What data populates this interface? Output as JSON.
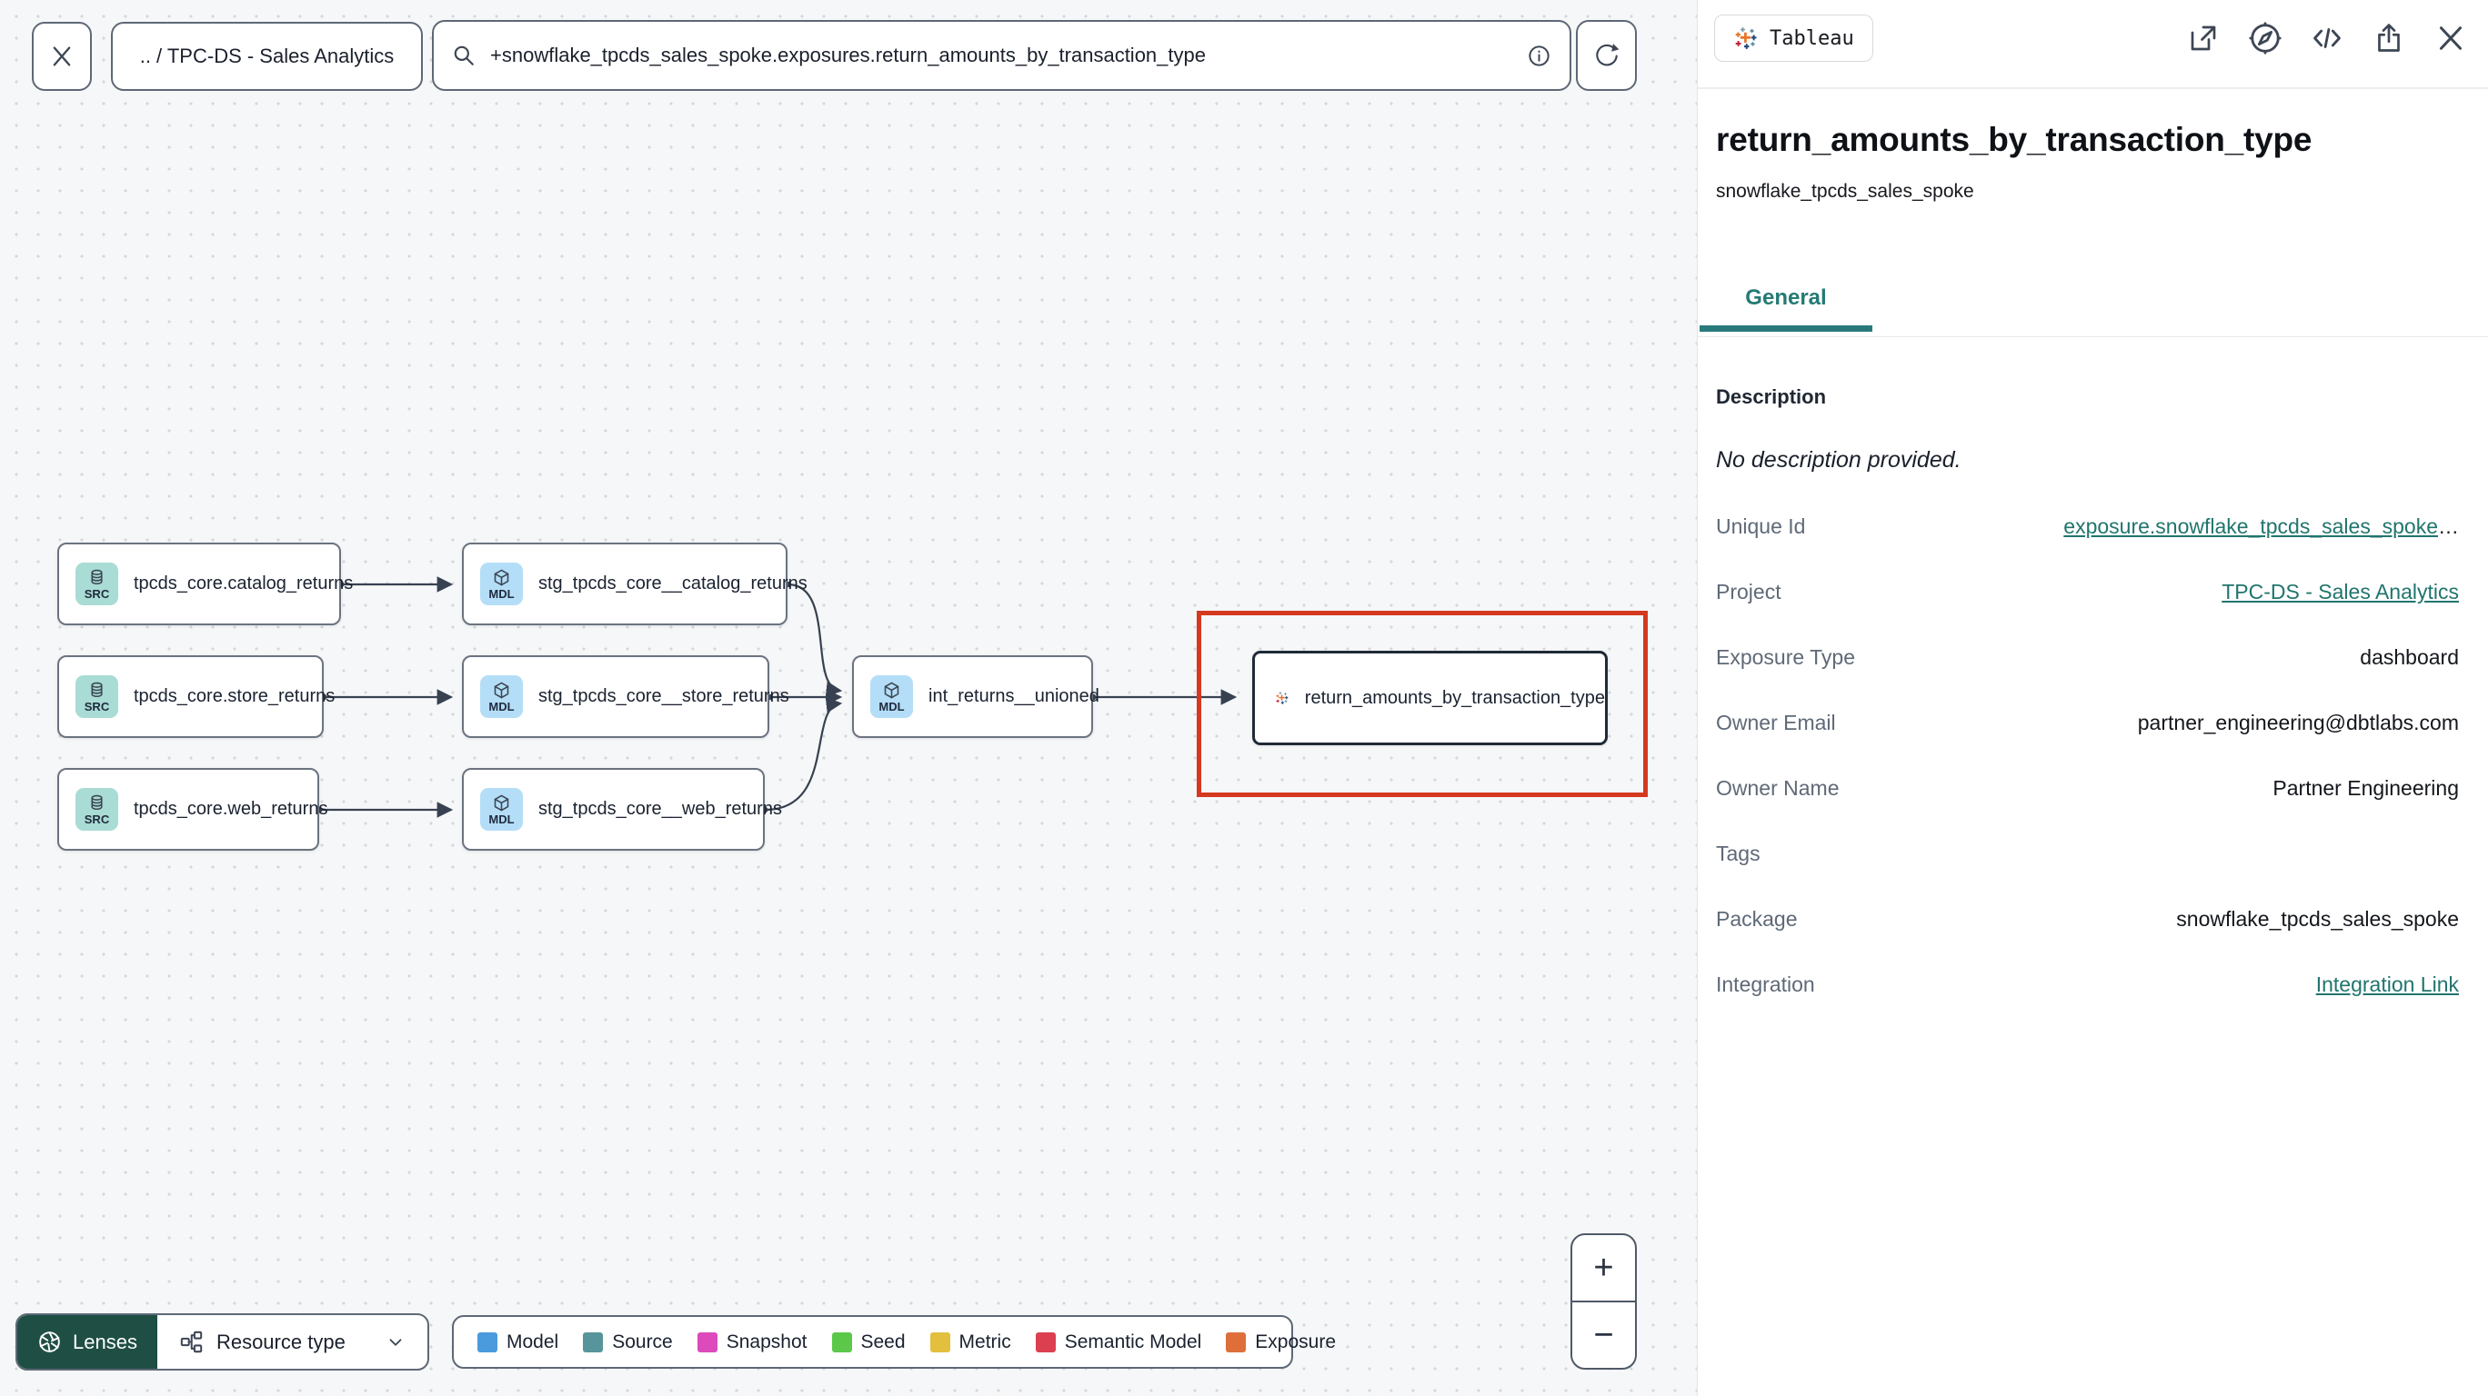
{
  "topbar": {
    "breadcrumb": ".. / TPC-DS - Sales Analytics",
    "search_value": "+snowflake_tpcds_sales_spoke.exposures.return_amounts_by_transaction_type"
  },
  "graph": {
    "nodes": [
      {
        "type": "source",
        "badge": "SRC",
        "label": "tpcds_core.catalog_returns"
      },
      {
        "type": "source",
        "badge": "SRC",
        "label": "tpcds_core.store_returns"
      },
      {
        "type": "source",
        "badge": "SRC",
        "label": "tpcds_core.web_returns"
      },
      {
        "type": "model",
        "badge": "MDL",
        "label": "stg_tpcds_core__catalog_returns"
      },
      {
        "type": "model",
        "badge": "MDL",
        "label": "stg_tpcds_core__store_returns"
      },
      {
        "type": "model",
        "badge": "MDL",
        "label": "stg_tpcds_core__web_returns"
      },
      {
        "type": "model",
        "badge": "MDL",
        "label": "int_returns__unioned"
      },
      {
        "type": "exposure",
        "badge": "",
        "label": "return_amounts_by_transaction_type"
      }
    ]
  },
  "panel": {
    "badge_label": "Tableau",
    "title": "return_amounts_by_transaction_type",
    "subtitle": "snowflake_tpcds_sales_spoke",
    "tab_label": "General",
    "description_label": "Description",
    "description_value": "No description provided.",
    "fields": [
      {
        "label": "Unique Id",
        "value": "exposure.snowflake_tpcds_sales_spoke",
        "suffix": "…",
        "link": true
      },
      {
        "label": "Project",
        "value": "TPC-DS - Sales Analytics",
        "suffix": "",
        "link": true
      },
      {
        "label": "Exposure Type",
        "value": "dashboard",
        "suffix": "",
        "link": false
      },
      {
        "label": "Owner Email",
        "value": "partner_engineering@dbtlabs.com",
        "suffix": "",
        "link": false
      },
      {
        "label": "Owner Name",
        "value": "Partner Engineering",
        "suffix": "",
        "link": false
      },
      {
        "label": "Tags",
        "value": "",
        "suffix": "",
        "link": false
      },
      {
        "label": "Package",
        "value": "snowflake_tpcds_sales_spoke",
        "suffix": "",
        "link": false
      },
      {
        "label": "Integration",
        "value": "Integration Link",
        "suffix": "",
        "link": true
      }
    ]
  },
  "footer": {
    "lenses_label": "Lenses",
    "resource_type_label": "Resource type",
    "legend": [
      {
        "label": "Model",
        "color": "#4a9bdd"
      },
      {
        "label": "Source",
        "color": "#58949b"
      },
      {
        "label": "Snapshot",
        "color": "#dd4abc"
      },
      {
        "label": "Seed",
        "color": "#5bc84a"
      },
      {
        "label": "Metric",
        "color": "#e3bf3e"
      },
      {
        "label": "Semantic Model",
        "color": "#dc4050"
      },
      {
        "label": "Exposure",
        "color": "#de6f3b"
      }
    ],
    "zoom_in_label": "+",
    "zoom_out_label": "−"
  }
}
